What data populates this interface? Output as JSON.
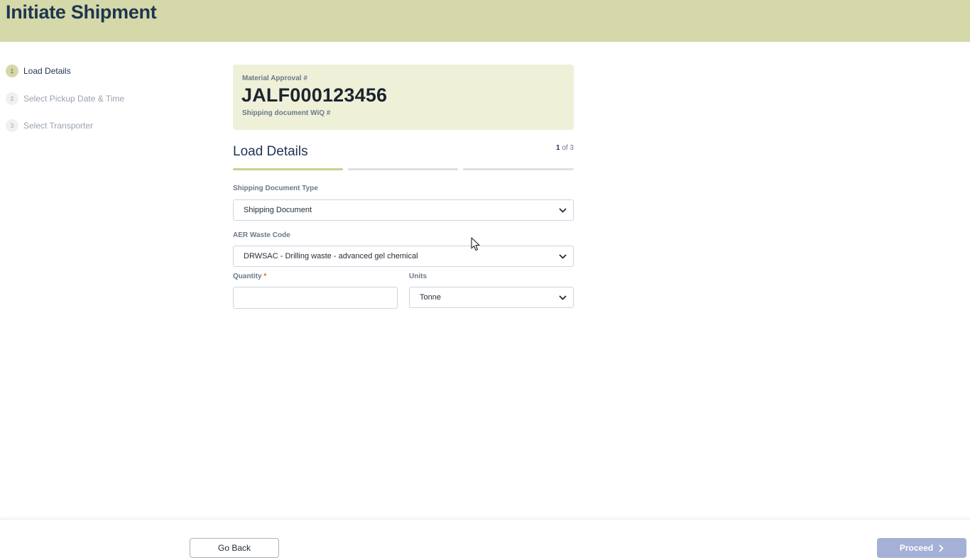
{
  "header": {
    "title": "Initiate Shipment",
    "bg_color": "#d5d8a8"
  },
  "steps": [
    {
      "number": "1",
      "label": "Load Details",
      "active": true
    },
    {
      "number": "2",
      "label": "Select Pickup Date & Time",
      "active": false
    },
    {
      "number": "3",
      "label": "Select Transporter",
      "active": false
    }
  ],
  "material": {
    "approval_caption": "Material Approval #",
    "approval_code": "JALF000123456",
    "shipping_caption": "Shipping document WiQ #"
  },
  "section": {
    "title": "Load Details",
    "current": "1",
    "of_text": "of 3",
    "progress_segments": 3,
    "progress_done": 1
  },
  "fields": {
    "doc_type": {
      "label": "Shipping Document Type",
      "value": "Shipping Document"
    },
    "waste_code": {
      "label": "AER Waste Code",
      "value": "DRWSAC - Drilling waste - advanced gel chemical"
    },
    "quantity": {
      "label": "Quantity",
      "required_mark": "*",
      "value": ""
    },
    "units": {
      "label": "Units",
      "value": "Tonne"
    }
  },
  "footer": {
    "back_label": "Go Back",
    "proceed_label": "Proceed",
    "proceed_color": "#a4b0d6"
  },
  "icons": {
    "select_chevron": "chevron-down-icon",
    "proceed_arrow": "chevron-right-icon",
    "cursor": "mouse-pointer-icon"
  }
}
